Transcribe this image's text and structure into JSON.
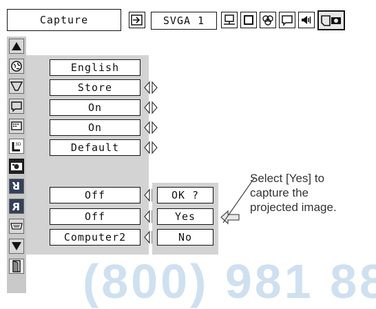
{
  "toolbar": {
    "title": "Capture",
    "mode": "SVGA 1",
    "icons": [
      "input-icon",
      "image-adjust-icon",
      "screen-icon",
      "color-icon",
      "setting-icon",
      "sound-icon",
      "capture-icon"
    ]
  },
  "sidebar": {
    "icons": [
      "up-arrow-icon",
      "language-icon",
      "keystone-icon",
      "blue-back-icon",
      "display-icon",
      "logo-icon",
      "capture-icon",
      "ceiling-icon",
      "rear-icon",
      "terminal-icon",
      "down-arrow-icon",
      "exit-icon"
    ]
  },
  "settings": [
    {
      "name": "language",
      "value": "English",
      "arrows": false
    },
    {
      "name": "keystone",
      "value": "Store",
      "arrows": true
    },
    {
      "name": "blue-back",
      "value": "On",
      "arrows": true
    },
    {
      "name": "display",
      "value": "On",
      "arrows": true
    },
    {
      "name": "logo",
      "value": "Default",
      "arrows": true
    },
    {
      "name": "ceiling",
      "value": "Off",
      "arrows": true
    },
    {
      "name": "rear",
      "value": "Off",
      "arrows": true
    },
    {
      "name": "terminal",
      "value": "Computer2",
      "arrows": true
    }
  ],
  "dialog": {
    "prompt": "OK ?",
    "yes": "Yes",
    "no": "No"
  },
  "callout": {
    "line1": "Select [Yes] to",
    "line2": "capture the",
    "line3": "projected image."
  },
  "watermark": "(800) 981 88"
}
